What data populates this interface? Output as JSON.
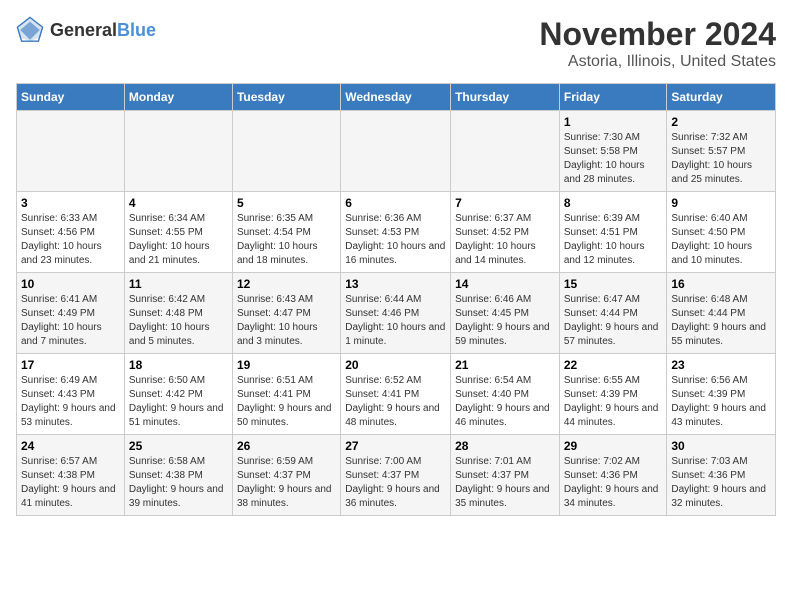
{
  "header": {
    "logo_general": "General",
    "logo_blue": "Blue",
    "title": "November 2024",
    "subtitle": "Astoria, Illinois, United States"
  },
  "columns": [
    "Sunday",
    "Monday",
    "Tuesday",
    "Wednesday",
    "Thursday",
    "Friday",
    "Saturday"
  ],
  "weeks": [
    [
      {
        "day": "",
        "info": ""
      },
      {
        "day": "",
        "info": ""
      },
      {
        "day": "",
        "info": ""
      },
      {
        "day": "",
        "info": ""
      },
      {
        "day": "",
        "info": ""
      },
      {
        "day": "1",
        "info": "Sunrise: 7:30 AM\nSunset: 5:58 PM\nDaylight: 10 hours and 28 minutes."
      },
      {
        "day": "2",
        "info": "Sunrise: 7:32 AM\nSunset: 5:57 PM\nDaylight: 10 hours and 25 minutes."
      }
    ],
    [
      {
        "day": "3",
        "info": "Sunrise: 6:33 AM\nSunset: 4:56 PM\nDaylight: 10 hours and 23 minutes."
      },
      {
        "day": "4",
        "info": "Sunrise: 6:34 AM\nSunset: 4:55 PM\nDaylight: 10 hours and 21 minutes."
      },
      {
        "day": "5",
        "info": "Sunrise: 6:35 AM\nSunset: 4:54 PM\nDaylight: 10 hours and 18 minutes."
      },
      {
        "day": "6",
        "info": "Sunrise: 6:36 AM\nSunset: 4:53 PM\nDaylight: 10 hours and 16 minutes."
      },
      {
        "day": "7",
        "info": "Sunrise: 6:37 AM\nSunset: 4:52 PM\nDaylight: 10 hours and 14 minutes."
      },
      {
        "day": "8",
        "info": "Sunrise: 6:39 AM\nSunset: 4:51 PM\nDaylight: 10 hours and 12 minutes."
      },
      {
        "day": "9",
        "info": "Sunrise: 6:40 AM\nSunset: 4:50 PM\nDaylight: 10 hours and 10 minutes."
      }
    ],
    [
      {
        "day": "10",
        "info": "Sunrise: 6:41 AM\nSunset: 4:49 PM\nDaylight: 10 hours and 7 minutes."
      },
      {
        "day": "11",
        "info": "Sunrise: 6:42 AM\nSunset: 4:48 PM\nDaylight: 10 hours and 5 minutes."
      },
      {
        "day": "12",
        "info": "Sunrise: 6:43 AM\nSunset: 4:47 PM\nDaylight: 10 hours and 3 minutes."
      },
      {
        "day": "13",
        "info": "Sunrise: 6:44 AM\nSunset: 4:46 PM\nDaylight: 10 hours and 1 minute."
      },
      {
        "day": "14",
        "info": "Sunrise: 6:46 AM\nSunset: 4:45 PM\nDaylight: 9 hours and 59 minutes."
      },
      {
        "day": "15",
        "info": "Sunrise: 6:47 AM\nSunset: 4:44 PM\nDaylight: 9 hours and 57 minutes."
      },
      {
        "day": "16",
        "info": "Sunrise: 6:48 AM\nSunset: 4:44 PM\nDaylight: 9 hours and 55 minutes."
      }
    ],
    [
      {
        "day": "17",
        "info": "Sunrise: 6:49 AM\nSunset: 4:43 PM\nDaylight: 9 hours and 53 minutes."
      },
      {
        "day": "18",
        "info": "Sunrise: 6:50 AM\nSunset: 4:42 PM\nDaylight: 9 hours and 51 minutes."
      },
      {
        "day": "19",
        "info": "Sunrise: 6:51 AM\nSunset: 4:41 PM\nDaylight: 9 hours and 50 minutes."
      },
      {
        "day": "20",
        "info": "Sunrise: 6:52 AM\nSunset: 4:41 PM\nDaylight: 9 hours and 48 minutes."
      },
      {
        "day": "21",
        "info": "Sunrise: 6:54 AM\nSunset: 4:40 PM\nDaylight: 9 hours and 46 minutes."
      },
      {
        "day": "22",
        "info": "Sunrise: 6:55 AM\nSunset: 4:39 PM\nDaylight: 9 hours and 44 minutes."
      },
      {
        "day": "23",
        "info": "Sunrise: 6:56 AM\nSunset: 4:39 PM\nDaylight: 9 hours and 43 minutes."
      }
    ],
    [
      {
        "day": "24",
        "info": "Sunrise: 6:57 AM\nSunset: 4:38 PM\nDaylight: 9 hours and 41 minutes."
      },
      {
        "day": "25",
        "info": "Sunrise: 6:58 AM\nSunset: 4:38 PM\nDaylight: 9 hours and 39 minutes."
      },
      {
        "day": "26",
        "info": "Sunrise: 6:59 AM\nSunset: 4:37 PM\nDaylight: 9 hours and 38 minutes."
      },
      {
        "day": "27",
        "info": "Sunrise: 7:00 AM\nSunset: 4:37 PM\nDaylight: 9 hours and 36 minutes."
      },
      {
        "day": "28",
        "info": "Sunrise: 7:01 AM\nSunset: 4:37 PM\nDaylight: 9 hours and 35 minutes."
      },
      {
        "day": "29",
        "info": "Sunrise: 7:02 AM\nSunset: 4:36 PM\nDaylight: 9 hours and 34 minutes."
      },
      {
        "day": "30",
        "info": "Sunrise: 7:03 AM\nSunset: 4:36 PM\nDaylight: 9 hours and 32 minutes."
      }
    ]
  ]
}
